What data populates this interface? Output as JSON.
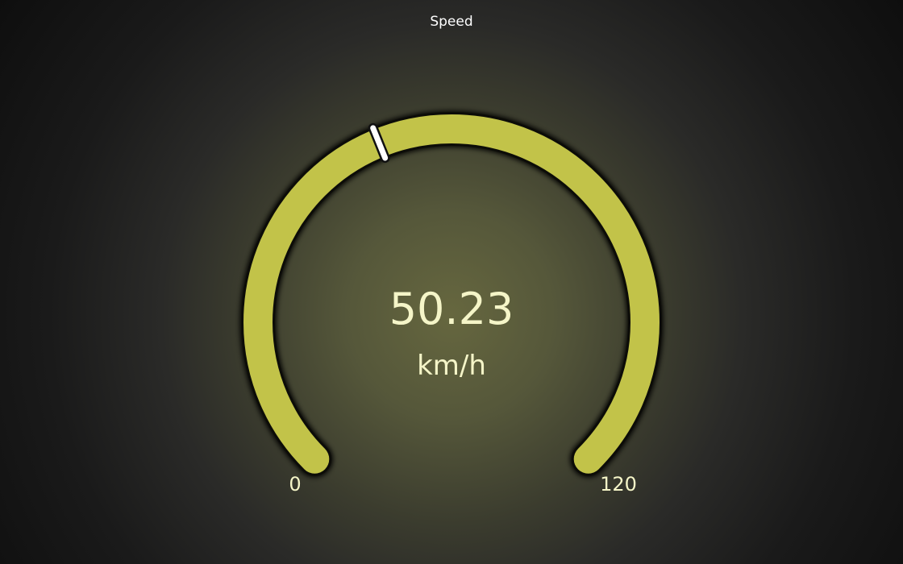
{
  "gauge": {
    "title": "Speed",
    "value": 50.23,
    "value_text": "50.23",
    "unit": "km/h",
    "min": 0,
    "max": 120,
    "min_label": "0",
    "max_label": "120",
    "arc_color": "#c2c349",
    "arc_outline_color": "#0c0c08",
    "marker_color": "#ffffff"
  }
}
